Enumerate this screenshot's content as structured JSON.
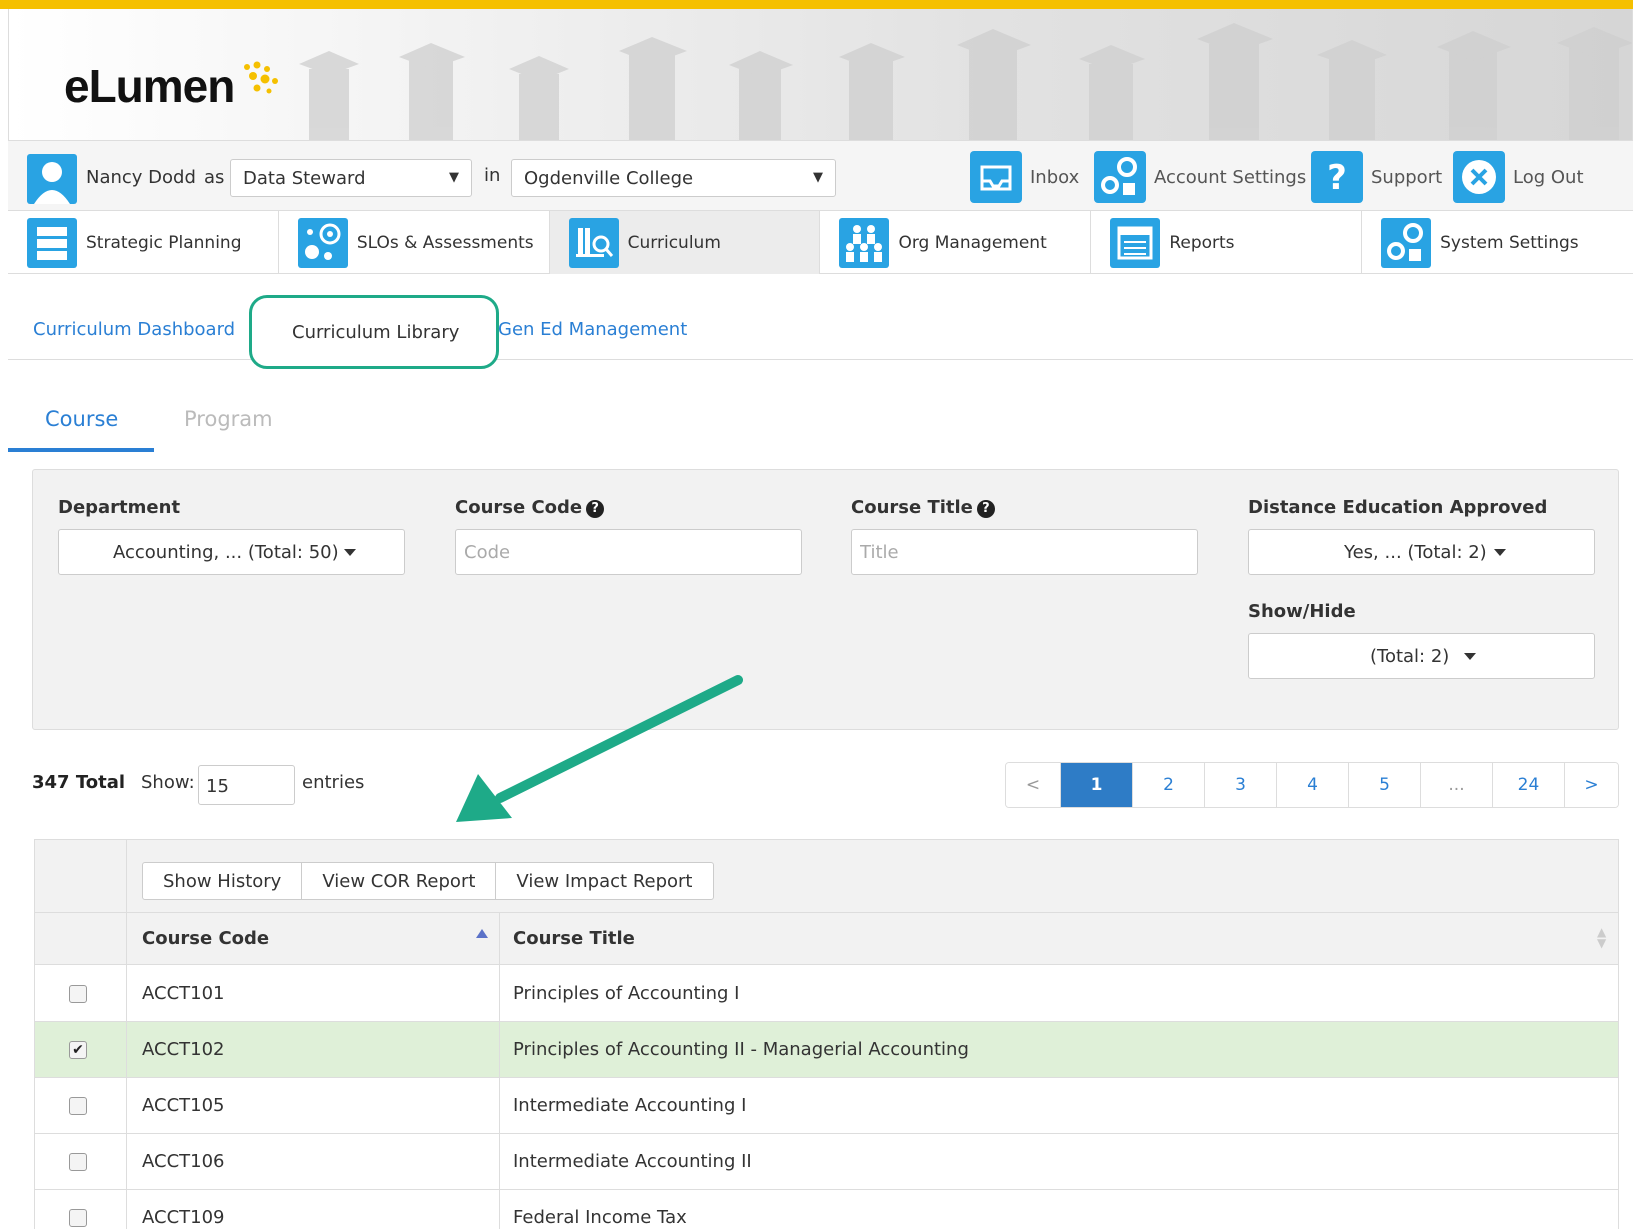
{
  "app": {
    "logo_text": "eLumen"
  },
  "user": {
    "name": "Nancy Dodd",
    "as_label": "as",
    "role": "Data Steward",
    "in_label": "in",
    "institution": "Ogdenville College"
  },
  "utility_nav": [
    {
      "label": "Inbox",
      "icon": "inbox-icon"
    },
    {
      "label": "Account Settings",
      "icon": "gears-lock-icon"
    },
    {
      "label": "Support",
      "icon": "question-icon"
    },
    {
      "label": "Log Out",
      "icon": "close-icon"
    }
  ],
  "main_nav": [
    {
      "label": "Strategic Planning",
      "icon": "server-stack-icon",
      "active": false
    },
    {
      "label": "SLOs & Assessments",
      "icon": "target-bubbles-icon",
      "active": false
    },
    {
      "label": "Curriculum",
      "icon": "library-search-icon",
      "active": true
    },
    {
      "label": "Org Management",
      "icon": "people-group-icon",
      "active": false
    },
    {
      "label": "Reports",
      "icon": "report-list-icon",
      "active": false
    },
    {
      "label": "System Settings",
      "icon": "gears-lock-icon",
      "active": false
    }
  ],
  "sub_nav": {
    "dashboard": "Curriculum Dashboard",
    "library": "Curriculum Library",
    "gen_ed": "Gen Ed Management"
  },
  "tabs": {
    "course": "Course",
    "program": "Program"
  },
  "filters": {
    "department_label": "Department",
    "department_value": "Accounting, ... (Total: 50)",
    "course_code_label": "Course Code",
    "course_code_placeholder": "Code",
    "course_title_label": "Course Title",
    "course_title_placeholder": "Title",
    "distance_label": "Distance Education Approved",
    "distance_value": "Yes, ... (Total: 2)",
    "showhide_label": "Show/Hide",
    "showhide_value": "(Total: 2)"
  },
  "listing": {
    "total": "347 Total",
    "show_label": "Show:",
    "show_value": "15",
    "entries_label": "entries"
  },
  "pagination": [
    "<",
    "1",
    "2",
    "3",
    "4",
    "5",
    "...",
    "24",
    ">"
  ],
  "pagination_active": "1",
  "toolbar": {
    "show_history": "Show History",
    "view_cor": "View COR Report",
    "view_impact": "View Impact Report"
  },
  "table": {
    "headers": {
      "code": "Course Code",
      "title": "Course Title"
    },
    "rows": [
      {
        "code": "ACCT101",
        "title": "Principles of Accounting I",
        "checked": false
      },
      {
        "code": "ACCT102",
        "title": "Principles of Accounting II - Managerial Accounting",
        "checked": true
      },
      {
        "code": "ACCT105",
        "title": "Intermediate Accounting I",
        "checked": false
      },
      {
        "code": "ACCT106",
        "title": "Intermediate Accounting II",
        "checked": false
      },
      {
        "code": "ACCT109",
        "title": "Federal Income Tax",
        "checked": false
      }
    ]
  },
  "colors": {
    "accent_bar": "#f5c000",
    "link_blue": "#2a7fd4",
    "icon_blue": "#29a3e3",
    "highlight_green": "#1eaa88",
    "selected_row": "#dff0d8"
  }
}
